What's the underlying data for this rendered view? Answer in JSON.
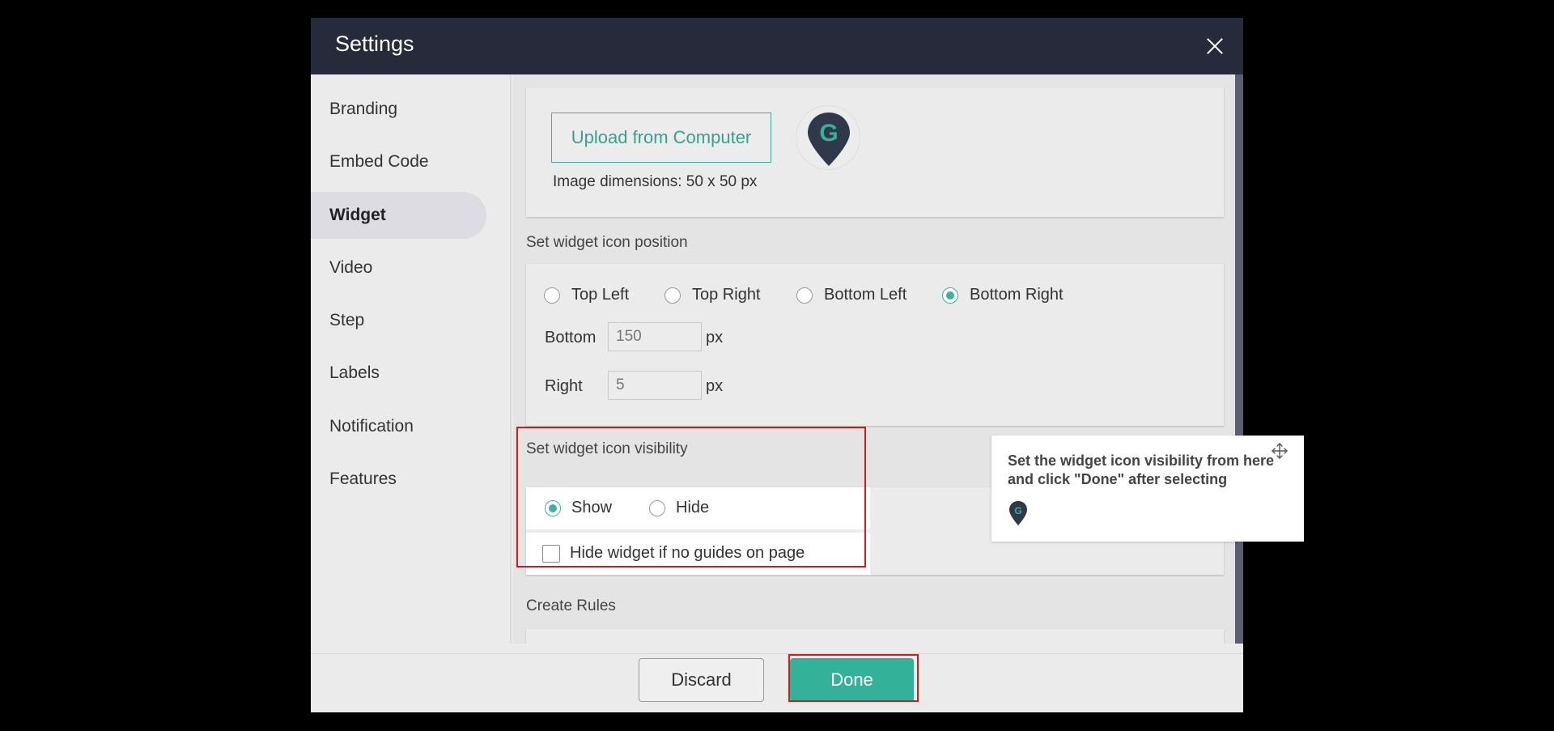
{
  "modal": {
    "title": "Settings",
    "close_icon": "close-icon"
  },
  "sidebar": {
    "items": [
      {
        "label": "Branding",
        "active": false
      },
      {
        "label": "Embed Code",
        "active": false
      },
      {
        "label": "Widget",
        "active": true
      },
      {
        "label": "Video",
        "active": false
      },
      {
        "label": "Step",
        "active": false
      },
      {
        "label": "Labels",
        "active": false
      },
      {
        "label": "Notification",
        "active": false
      },
      {
        "label": "Features",
        "active": false
      }
    ]
  },
  "widget": {
    "upload_label": "Upload from Computer",
    "logo_icon": "map-pin-g-logo-icon",
    "image_dimensions": "Image dimensions: 50 x 50 px",
    "position_section": "Set widget icon position",
    "position_options": [
      {
        "label": "Top Left",
        "checked": false
      },
      {
        "label": "Top Right",
        "checked": false
      },
      {
        "label": "Bottom Left",
        "checked": false
      },
      {
        "label": "Bottom Right",
        "checked": true
      }
    ],
    "bottom_label": "Bottom",
    "bottom_value": "150",
    "right_label": "Right",
    "right_value": "5",
    "unit": "px",
    "visibility_section": "Set widget icon visibility",
    "visibility_options": [
      {
        "label": "Show",
        "checked": true
      },
      {
        "label": "Hide",
        "checked": false
      }
    ],
    "hide_no_guides_label": "Hide widget if no guides on page",
    "hide_no_guides_checked": false,
    "create_rules_section": "Create Rules"
  },
  "footer": {
    "discard_label": "Discard",
    "done_label": "Done"
  },
  "tooltip": {
    "text": "Set the widget icon visibility from here and click \"Done\" after selecting",
    "move_icon": "move-icon",
    "logo_icon": "map-pin-g-logo-icon"
  },
  "colors": {
    "accent": "#34b199",
    "header": "#272a3a",
    "highlight": "#d7191c"
  }
}
